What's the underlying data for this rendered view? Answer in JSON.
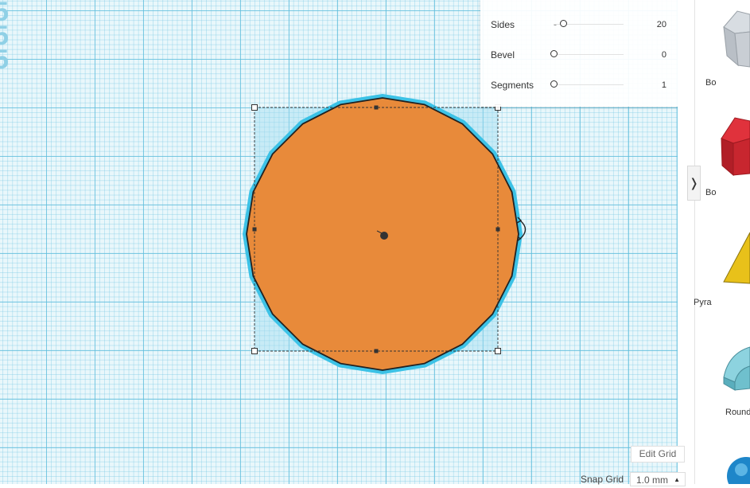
{
  "shape_params": {
    "rows": [
      {
        "label": "Sides",
        "value": "20",
        "fraction": 0.0
      },
      {
        "label": "Bevel",
        "value": "0",
        "fraction": 0.0
      },
      {
        "label": "Segments",
        "value": "1",
        "fraction": 0.0
      }
    ]
  },
  "selected_shape": {
    "sides": 20,
    "fill_color": "#e88a3a",
    "outline_color": "#222222",
    "highlight_color": "#3cc2e6"
  },
  "sidebar": {
    "collapse_icon": "chevron-right-icon",
    "shapes": [
      {
        "label": "Bo",
        "icon": "box-gray-icon"
      },
      {
        "label": "Bo",
        "icon": "box-red-icon"
      },
      {
        "label": "Pyra",
        "icon": "pyramid-yellow-icon"
      },
      {
        "label": "Round",
        "icon": "roundroof-teal-icon"
      },
      {
        "label": "",
        "icon": "sphere-blue-icon"
      }
    ]
  },
  "grid_controls": {
    "edit_grid_label": "Edit Grid",
    "snap_grid_label": "Snap Grid",
    "snap_grid_value": "1.0 mm"
  },
  "colors": {
    "workplane_bg": "#e9f7fb",
    "grid_line": "#60bedc",
    "panel_bg": "#ffffff"
  }
}
